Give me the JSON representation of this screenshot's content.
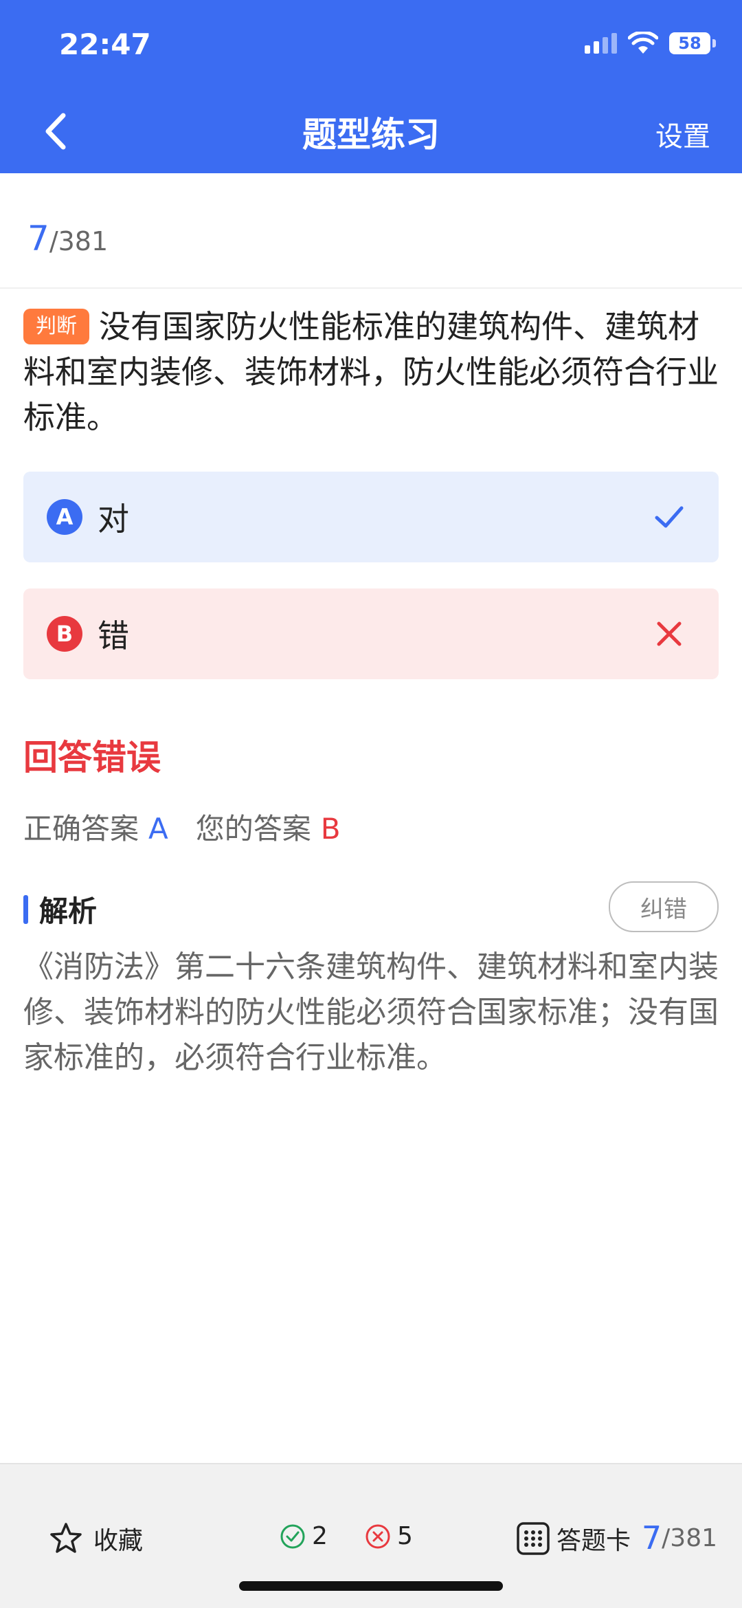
{
  "status": {
    "time": "22:47",
    "battery": "58"
  },
  "header": {
    "title": "题型练习",
    "settings_label": "设置"
  },
  "progress": {
    "current": "7",
    "total": "/381"
  },
  "question": {
    "tag": "判断",
    "text": "没有国家防火性能标准的建筑构件、建筑材料和室内装修、装饰材料，防火性能必须符合行业标准。"
  },
  "options": [
    {
      "letter": "A",
      "text": "对",
      "state": "correct"
    },
    {
      "letter": "B",
      "text": "错",
      "state": "wrong"
    }
  ],
  "result": {
    "title": "回答错误",
    "correct_label": "正确答案",
    "correct_value": "A",
    "your_label": "您的答案",
    "your_value": "B"
  },
  "analysis": {
    "title": "解析",
    "report_label": "纠错",
    "text": "《消防法》第二十六条建筑构件、建筑材料和室内装修、装饰材料的防火性能必须符合国家标准；没有国家标准的，必须符合行业标准。"
  },
  "bottom": {
    "favorite_label": "收藏",
    "correct_count": "2",
    "wrong_count": "5",
    "card_label": "答题卡",
    "current": "7",
    "total": "/381"
  },
  "colors": {
    "primary": "#3b6cf2",
    "error": "#e8393f",
    "tag": "#ff7a3d",
    "success": "#22a35a"
  }
}
